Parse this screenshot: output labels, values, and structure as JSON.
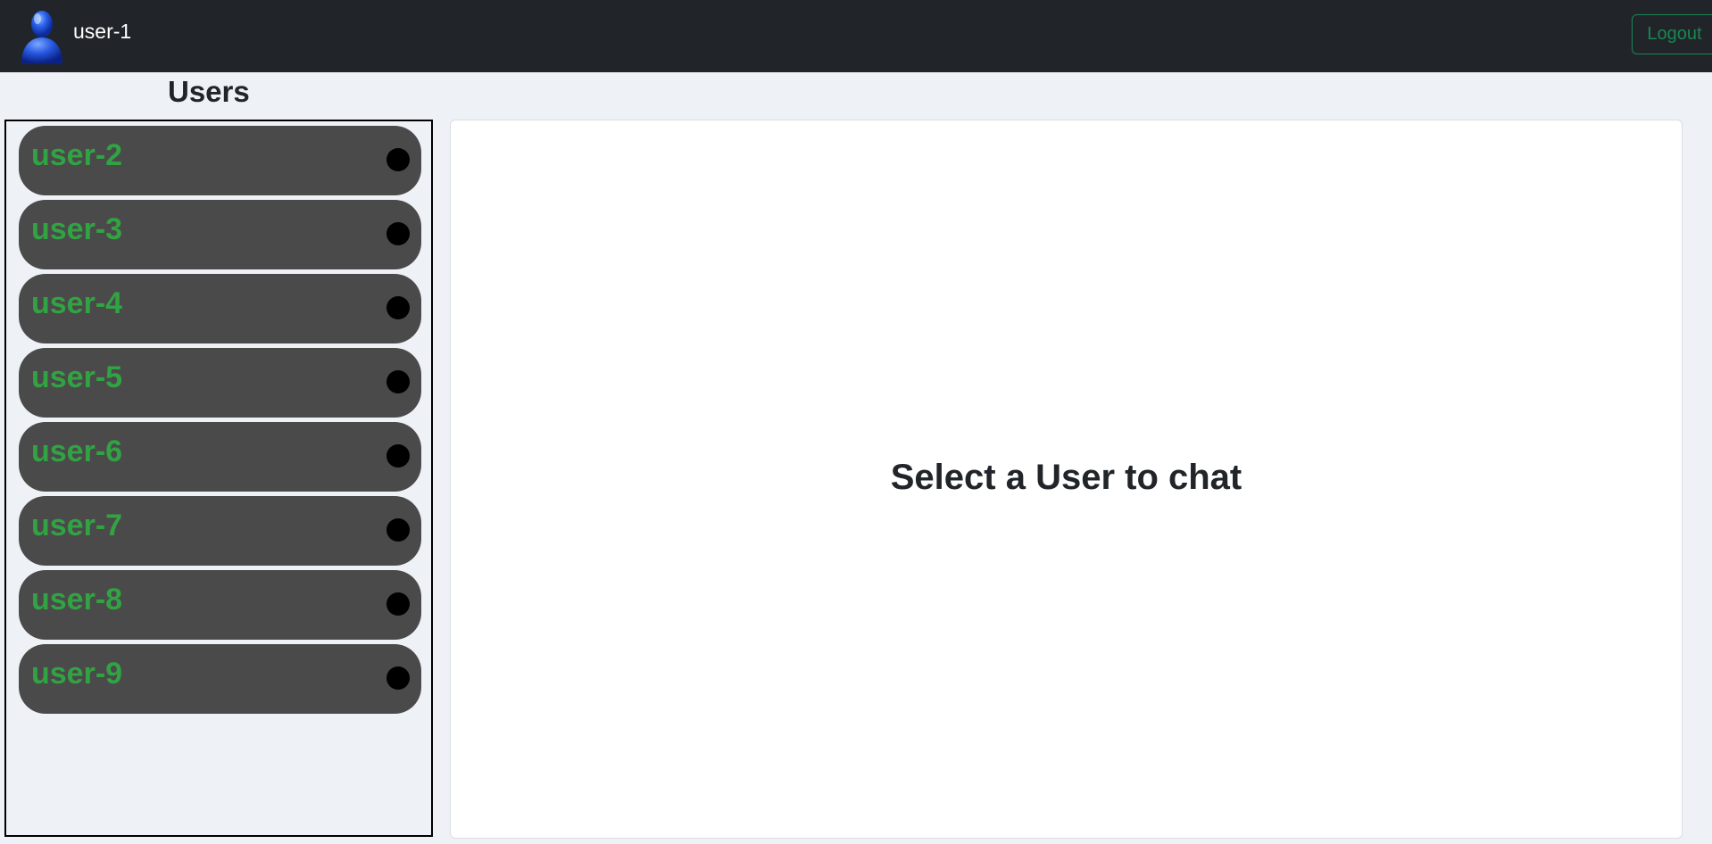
{
  "header": {
    "username": "user-1",
    "logout_label": "Logout",
    "avatar_icon": "user-avatar-icon"
  },
  "sidebar": {
    "title": "Users",
    "users": [
      {
        "label": "user-2",
        "status": "offline"
      },
      {
        "label": "user-3",
        "status": "offline"
      },
      {
        "label": "user-4",
        "status": "offline"
      },
      {
        "label": "user-5",
        "status": "offline"
      },
      {
        "label": "user-6",
        "status": "offline"
      },
      {
        "label": "user-7",
        "status": "offline"
      },
      {
        "label": "user-8",
        "status": "offline"
      },
      {
        "label": "user-9",
        "status": "offline"
      }
    ]
  },
  "chat": {
    "placeholder": "Select a User to chat"
  },
  "colors": {
    "navbar": "#212529",
    "accent_green": "#198754",
    "user_label_green": "#31a343",
    "user_item_bg": "#4a4a4a",
    "page_bg": "#eef2f6"
  }
}
